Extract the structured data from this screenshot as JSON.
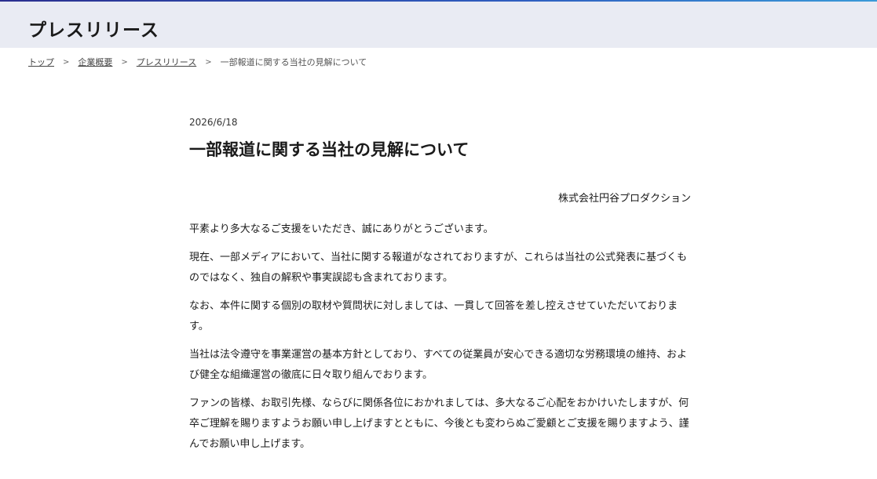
{
  "header": {
    "title": "プレスリリース",
    "accent_colors": [
      "#2a2f8f",
      "#3a9ad8"
    ],
    "band_color": "#e9ebf3"
  },
  "breadcrumb": {
    "items": [
      "トップ",
      "企業概要",
      "プレスリリース"
    ],
    "current": "一部報道に関する当社の見解について",
    "separator": ">"
  },
  "article": {
    "date": "2026/6/18",
    "title": "一部報道に関する当社の見解について",
    "company": "株式会社円谷プロダクション",
    "paragraphs": [
      "平素より多大なるご支援をいただき、誠にありがとうございます。",
      "現在、一部メディアにおいて、当社に関する報道がなされておりますが、これらは当社の公式発表に基づくものではなく、独自の解釈や事実誤認も含まれております。",
      "なお、本件に関する個別の取材や質問状に対しましては、一貫して回答を差し控えさせていただいております。",
      "当社は法令遵守を事業運営の基本方針としており、すべての従業員が安心できる適切な労務環境の維持、および健全な組織運営の徹底に日々取り組んでおります。",
      "ファンの皆様、お取引先様、ならびに関係各位におかれましては、多大なるご心配をおかけいたしますが、何卒ご理解を賜りますようお願い申し上げますとともに、今後とも変わらぬご愛顧とご支援を賜りますよう、謹んでお願い申し上げます。"
    ]
  }
}
